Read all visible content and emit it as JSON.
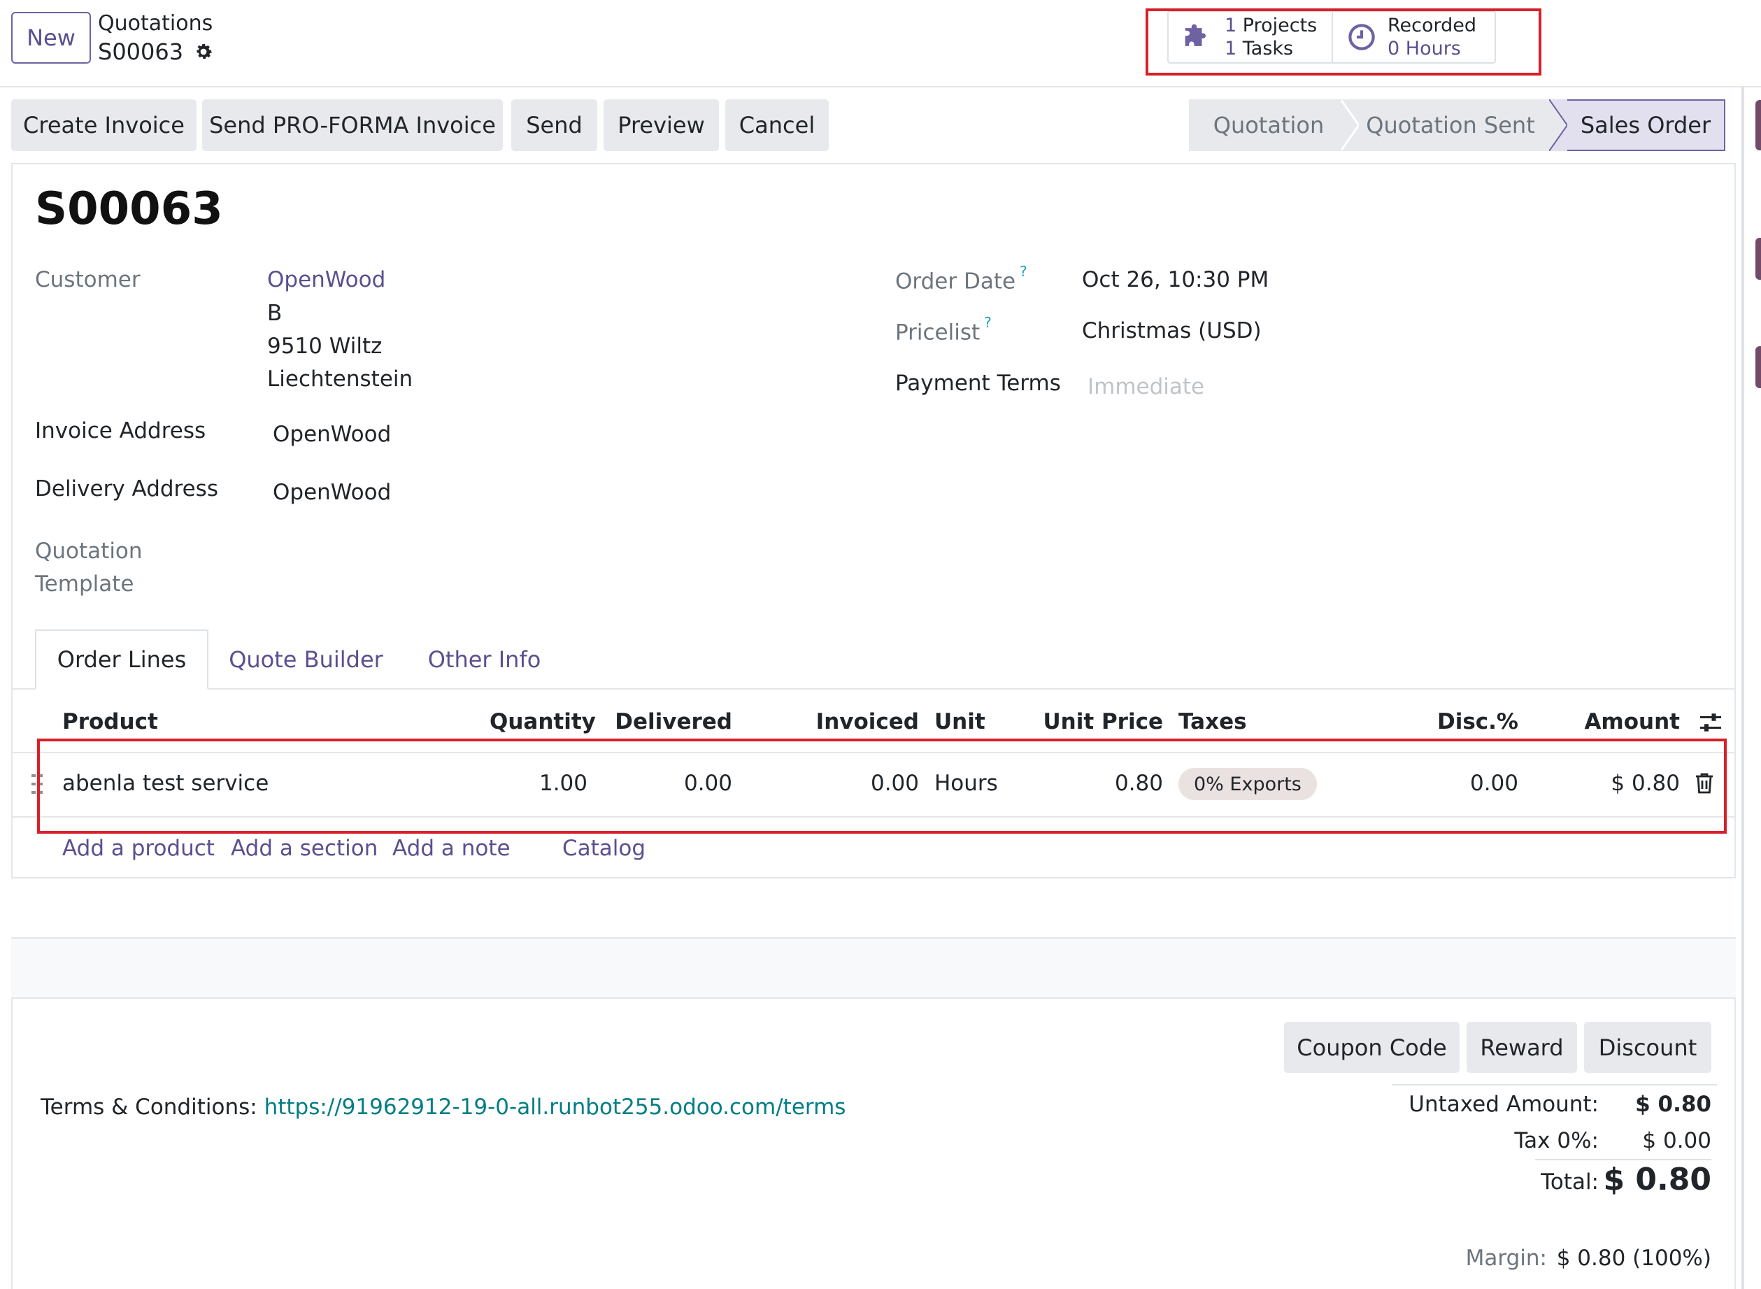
{
  "header": {
    "new_button": "New",
    "breadcrumb_parent": "Quotations",
    "breadcrumb_current": "S00063",
    "smart_buttons": {
      "projects_count": "1",
      "projects_label": "Projects",
      "tasks_count": "1",
      "tasks_label": "Tasks",
      "recorded_label": "Recorded",
      "recorded_value": "0 Hours"
    }
  },
  "actions": {
    "create_invoice": "Create Invoice",
    "send_proforma": "Send PRO-FORMA Invoice",
    "send": "Send",
    "preview": "Preview",
    "cancel": "Cancel"
  },
  "statusbar": {
    "steps": [
      "Quotation",
      "Quotation Sent",
      "Sales Order"
    ],
    "active": "Sales Order"
  },
  "form": {
    "title": "S00063",
    "customer_label": "Customer",
    "customer_name": "OpenWood",
    "customer_address": [
      "B",
      "9510 Wiltz",
      "Liechtenstein"
    ],
    "invoice_address_label": "Invoice Address",
    "invoice_address_value": "OpenWood",
    "delivery_address_label": "Delivery Address",
    "delivery_address_value": "OpenWood",
    "quotation_template_label_1": "Quotation",
    "quotation_template_label_2": "Template",
    "order_date_label": "Order Date",
    "order_date_value": "Oct 26, 10:30 PM",
    "pricelist_label": "Pricelist",
    "pricelist_value": "Christmas (USD)",
    "payment_terms_label": "Payment Terms",
    "payment_terms_placeholder": "Immediate",
    "help_mark": "?"
  },
  "tabs": [
    "Order Lines",
    "Quote Builder",
    "Other Info"
  ],
  "order_lines": {
    "columns": [
      "Product",
      "Quantity",
      "Delivered",
      "Invoiced",
      "Unit",
      "Unit Price",
      "Taxes",
      "Disc.%",
      "Amount"
    ],
    "rows": [
      {
        "product": "abenla test service",
        "quantity": "1.00",
        "delivered": "0.00",
        "invoiced": "0.00",
        "unit": "Hours",
        "unit_price": "0.80",
        "taxes": "0% Exports",
        "discount": "0.00",
        "amount": "$ 0.80"
      }
    ],
    "add_links": [
      "Add a product",
      "Add a section",
      "Add a note",
      "Catalog"
    ]
  },
  "footer": {
    "buttons": [
      "Coupon Code",
      "Reward",
      "Discount"
    ],
    "terms_label": "Terms & Conditions:",
    "terms_url": "https://91962912-19-0-all.runbot255.odoo.com/terms",
    "untaxed_label": "Untaxed Amount:",
    "untaxed_value": "$ 0.80",
    "tax_label": "Tax 0%:",
    "tax_value": "$ 0.00",
    "total_label": "Total:",
    "total_value": "$ 0.80",
    "margin_label": "Margin:",
    "margin_value": "$ 0.80 (100%)"
  },
  "colors": {
    "accent": "#5c4f8f",
    "link_teal": "#017e84",
    "highlight_box": "#d9202a",
    "button_gray": "#e7e9ed"
  }
}
